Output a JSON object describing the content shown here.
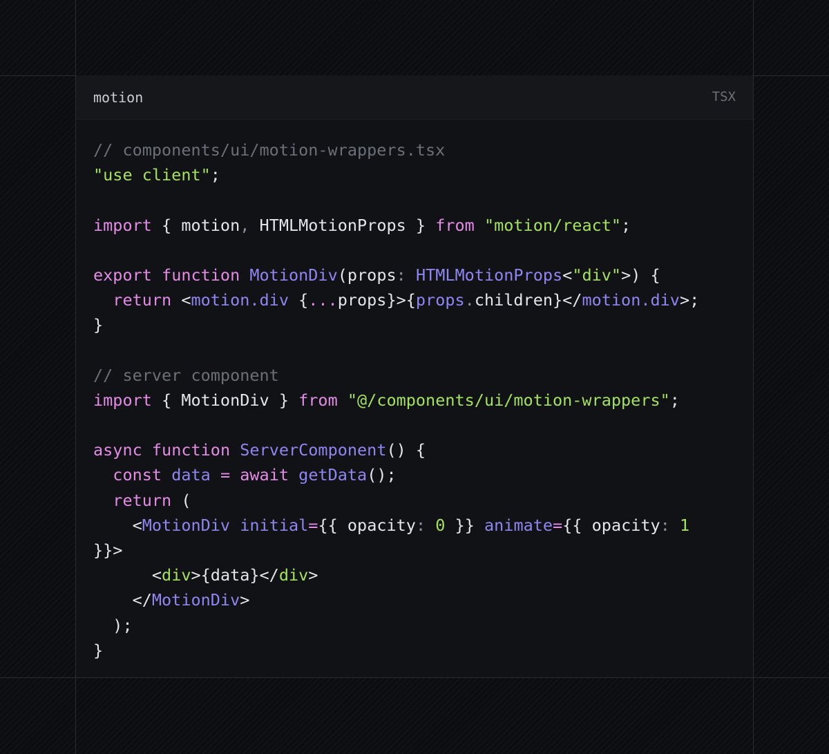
{
  "code_block": {
    "title": "motion",
    "language": "TSX",
    "colors": {
      "comment": "#6b6f78",
      "string": "#a4e15d",
      "keyword": "#e48be6",
      "function": "#8e86f1",
      "plain": "#e4e6ec",
      "punctuation": "#8c90a0",
      "number": "#a4e15d",
      "background": "#111215",
      "header_background": "#16171b"
    },
    "lines": [
      [
        [
          "comment",
          "// components/ui/motion-wrappers.tsx"
        ]
      ],
      [
        [
          "string",
          "\"use client\""
        ],
        [
          "plain",
          ";"
        ]
      ],
      [],
      [
        [
          "keyword",
          "import"
        ],
        [
          "plain",
          " { motion"
        ],
        [
          "punct",
          ","
        ],
        [
          "plain",
          " HTMLMotionProps } "
        ],
        [
          "keyword",
          "from"
        ],
        [
          "plain",
          " "
        ],
        [
          "string",
          "\"motion/react\""
        ],
        [
          "plain",
          ";"
        ]
      ],
      [],
      [
        [
          "keyword",
          "export"
        ],
        [
          "plain",
          " "
        ],
        [
          "keyword",
          "function"
        ],
        [
          "plain",
          " "
        ],
        [
          "func",
          "MotionDiv"
        ],
        [
          "plain",
          "(props"
        ],
        [
          "punct",
          ":"
        ],
        [
          "plain",
          " "
        ],
        [
          "func",
          "HTMLMotionProps"
        ],
        [
          "plain",
          "<"
        ],
        [
          "string",
          "\"div\""
        ],
        [
          "plain",
          ">) {"
        ]
      ],
      [
        [
          "plain",
          "  "
        ],
        [
          "keyword",
          "return"
        ],
        [
          "plain",
          " <"
        ],
        [
          "func",
          "motion.div"
        ],
        [
          "plain",
          " {"
        ],
        [
          "keyword",
          "..."
        ],
        [
          "plain",
          "props}>{"
        ],
        [
          "func",
          "props"
        ],
        [
          "punct",
          "."
        ],
        [
          "plain",
          "children}</"
        ],
        [
          "func",
          "motion.div"
        ],
        [
          "plain",
          ">;"
        ]
      ],
      [
        [
          "plain",
          "}"
        ]
      ],
      [],
      [
        [
          "comment",
          "// server component"
        ]
      ],
      [
        [
          "keyword",
          "import"
        ],
        [
          "plain",
          " { MotionDiv } "
        ],
        [
          "keyword",
          "from"
        ],
        [
          "plain",
          " "
        ],
        [
          "string",
          "\"@/components/ui/motion-wrappers\""
        ],
        [
          "plain",
          ";"
        ]
      ],
      [],
      [
        [
          "keyword",
          "async"
        ],
        [
          "plain",
          " "
        ],
        [
          "keyword",
          "function"
        ],
        [
          "plain",
          " "
        ],
        [
          "func",
          "ServerComponent"
        ],
        [
          "plain",
          "() {"
        ]
      ],
      [
        [
          "plain",
          "  "
        ],
        [
          "keyword",
          "const"
        ],
        [
          "plain",
          " "
        ],
        [
          "func",
          "data"
        ],
        [
          "plain",
          " "
        ],
        [
          "keyword",
          "="
        ],
        [
          "plain",
          " "
        ],
        [
          "keyword",
          "await"
        ],
        [
          "plain",
          " "
        ],
        [
          "func",
          "getData"
        ],
        [
          "plain",
          "();"
        ]
      ],
      [
        [
          "plain",
          "  "
        ],
        [
          "keyword",
          "return"
        ],
        [
          "plain",
          " ("
        ]
      ],
      [
        [
          "plain",
          "    <"
        ],
        [
          "func",
          "MotionDiv"
        ],
        [
          "plain",
          " "
        ],
        [
          "func",
          "initial"
        ],
        [
          "keyword",
          "="
        ],
        [
          "plain",
          "{{ opacity"
        ],
        [
          "punct",
          ":"
        ],
        [
          "plain",
          " "
        ],
        [
          "number",
          "0"
        ],
        [
          "plain",
          " }} "
        ],
        [
          "func",
          "animate"
        ],
        [
          "keyword",
          "="
        ],
        [
          "plain",
          "{{ opacity"
        ],
        [
          "punct",
          ":"
        ],
        [
          "plain",
          " "
        ],
        [
          "number",
          "1"
        ]
      ],
      [
        [
          "plain",
          "}}>"
        ]
      ],
      [
        [
          "plain",
          "      <"
        ],
        [
          "string",
          "div"
        ],
        [
          "plain",
          ">{data}</"
        ],
        [
          "string",
          "div"
        ],
        [
          "plain",
          ">"
        ]
      ],
      [
        [
          "plain",
          "    </"
        ],
        [
          "func",
          "MotionDiv"
        ],
        [
          "plain",
          ">"
        ]
      ],
      [
        [
          "plain",
          "  );"
        ]
      ],
      [
        [
          "plain",
          "}"
        ]
      ]
    ]
  }
}
